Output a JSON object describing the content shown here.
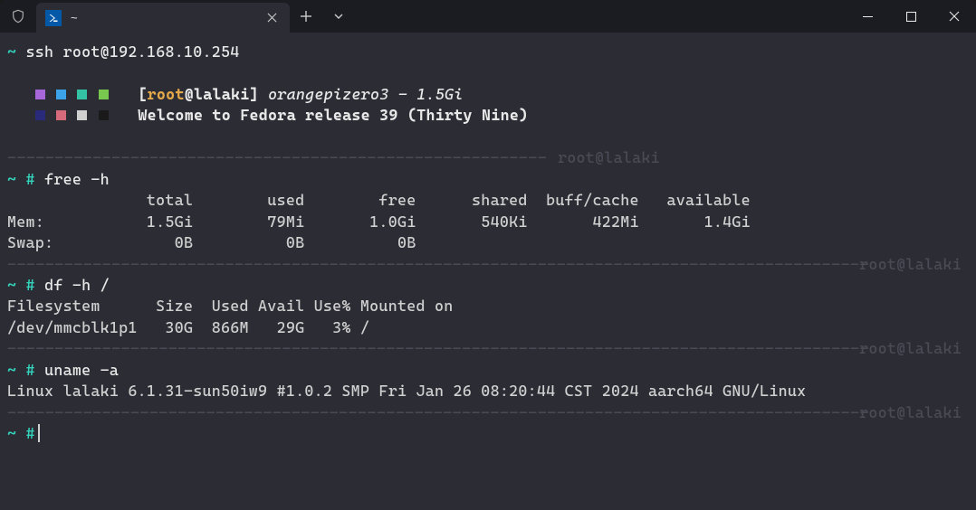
{
  "tab": {
    "title": "~"
  },
  "ssh": {
    "prompt": "~",
    "cmd": "ssh",
    "target": "root@192.168.10.254"
  },
  "motd": {
    "colors_row1": [
      "#a867d9",
      "#3da3e8",
      "#34c2a4",
      "#78c850"
    ],
    "colors_row2": [
      "#2a2a7a",
      "#d46a7a",
      "#d0d0d0",
      "#1a1a1a"
    ],
    "open_br": "[",
    "user": "root",
    "at": "@",
    "host": "lalaki",
    "close_br": "]",
    "device": "orangepizero3 - 1.5Gi",
    "welcome": "Welcome to Fedora release 39 (Thirty Nine)"
  },
  "ghost": "root@lalaki",
  "free": {
    "cmd": "free -h",
    "header": "               total        used        free      shared  buff/cache   available",
    "mem": "Mem:           1.5Gi        79Mi       1.0Gi       540Ki       422Mi       1.4Gi",
    "swap": "Swap:             0B          0B          0B"
  },
  "df": {
    "cmd": "df -h /",
    "header": "Filesystem      Size  Used Avail Use% Mounted on",
    "row": "/dev/mmcblk1p1   30G  866M   29G   3% /"
  },
  "uname": {
    "cmd": "uname -a",
    "out": "Linux lalaki 6.1.31-sun50iw9 #1.0.2 SMP Fri Jan 26 08:20:44 CST 2024 aarch64 GNU/Linux"
  },
  "dash_left": "---------------------------------------------------------",
  "dash_full": "-------------------------------------------------------------------------------------------"
}
